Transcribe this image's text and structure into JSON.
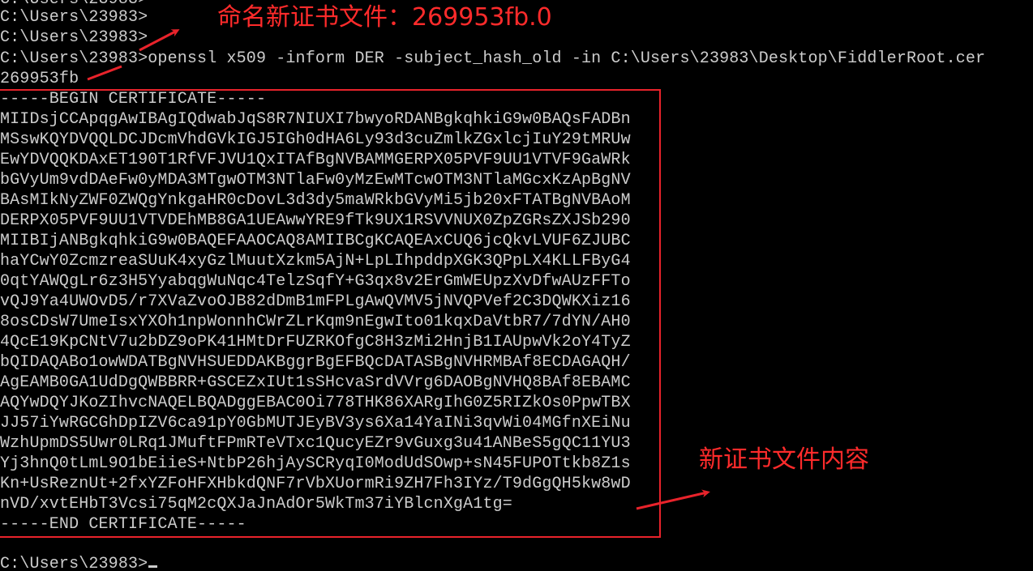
{
  "console": {
    "lines_before": [
      "C:\\Users\\23983>",
      "C:\\Users\\23983>",
      "C:\\Users\\23983>",
      "C:\\Users\\23983>openssl x509 -inform DER -subject_hash_old -in C:\\Users\\23983\\Desktop\\FiddlerRoot.cer",
      "269953fb"
    ],
    "certificate_lines": [
      "-----BEGIN CERTIFICATE-----",
      "MIIDsjCCApqgAwIBAgIQdwabJqS8R7NIUXI7bwyoRDANBgkqhkiG9w0BAQsFADBn",
      "MSswKQYDVQQLDCJDcmVhdGVkIGJ5IGh0dHA6Ly93d3cuZmlkZGxlcjIuY29tMRUw",
      "EwYDVQQKDAxET190T1RfVFJVU1QxITAfBgNVBAMMGERPX05PVF9UU1VTVF9GaWRk",
      "bGVyUm9vdDAeFw0yMDA3MTgwOTM3NTlaFw0yMzEwMTcwOTM3NTlaMGcxKzApBgNV",
      "BAsMIkNyZWF0ZWQgYnkgaHR0cDovL3d3dy5maWRkbGVyMi5jb20xFTATBgNVBAoM",
      "DERPX05PVF9UU1VTVDEhMB8GA1UEAwwYRE9fTk9UX1RSVVNUX0ZpZGRsZXJSb290",
      "MIIBIjANBgkqhkiG9w0BAQEFAAOCAQ8AMIIBCgKCAQEAxCUQ6jcQkvLVUF6ZJUBC",
      "haYCwY0ZcmzreaSUuK4xyGzlMuutXzkm5AjN+LpLIhpddpXGK3QPpLX4KLLFByG4",
      "0qtYAWQgLr6z3H5YyabqgWuNqc4TelzSqfY+G3qx8v2ErGmWEUpzXvDfwAUzFFTo",
      "vQJ9Ya4UWOvD5/r7XVaZvoOJB82dDmB1mFPLgAwQVMV5jNVQPVef2C3DQWKXiz16",
      "8osCDsW7UmeIsxYXOh1npWonnhCWrZLrKqm9nEgwIto01kqxDaVtbR7/7dYN/AH0",
      "4QcE19KpCNtV7u2bDZ9oPK41HMtDrFUZRKOfgC8H3zMi2HnjB1IAUpwVk2oY4TyZ",
      "bQIDAQABo1owWDATBgNVHSUEDDAKBggrBgEFBQcDATASBgNVHRMBAf8ECDAGAQH/",
      "AgEAMB0GA1UdDgQWBBRR+GSCEZxIUt1sSHcvaSrdVVrg6DAOBgNVHQ8BAf8EBAMC",
      "AQYwDQYJKoZIhvcNAQELBQADggEBAC0Oi778THK86XARgIhG0Z5RIZkOs0PpwTBX",
      "JJ57iYwRGCGhDpIZV6ca91pY0GbMUTJEyBV3ys6Xa14YaINi3qvWi04MGfnXEiNu",
      "WzhUpmDS5Uwr0LRq1JMuftFPmRTeVTxc1QucyEZr9vGuxg3u41ANBeS5gQC11YU3",
      "Yj3hnQ0tLmL9O1bEiieS+NtbP26hjAySCRyqI0ModUdSOwp+sN45FUPOTtkb8Z1s",
      "Kn+UsReznUt+2fxYZFoHFXHbkdQNF7rVbXUormRi9ZH7Fh3IYz/T9dGgQH5kw8wD",
      "nVD/xvtEHbT3Vcsi75qM2cQXJaJnAdOr5WkTm37iYBlcnXgA1tg=",
      "-----END CERTIFICATE-----"
    ],
    "last_prompt": "C:\\Users\\23983>"
  },
  "annotations": {
    "rename_text": "命名新证书文件：269953fb.0",
    "content_text": "新证书文件内容",
    "color": "#ff2b2b"
  },
  "colors": {
    "background": "#000000",
    "text": "#cccccc",
    "highlight": "#e8232b"
  }
}
